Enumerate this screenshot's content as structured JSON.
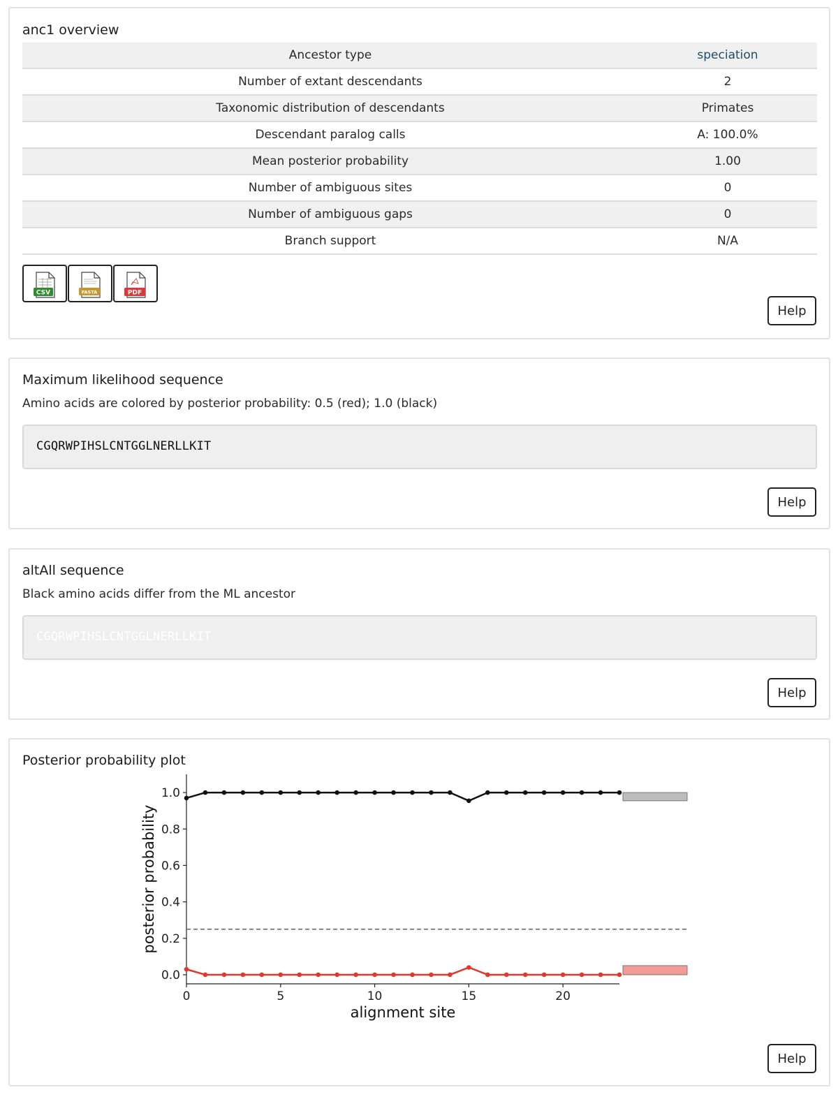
{
  "overview": {
    "title": "anc1 overview",
    "rows": [
      {
        "label": "Ancestor type",
        "value": "speciation"
      },
      {
        "label": "Number of extant descendants",
        "value": "2"
      },
      {
        "label": "Taxonomic distribution of descendants",
        "value": "Primates"
      },
      {
        "label": "Descendant paralog calls",
        "value": "A: 100.0%"
      },
      {
        "label": "Mean posterior probability",
        "value": "1.00"
      },
      {
        "label": "Number of ambiguous sites",
        "value": "0"
      },
      {
        "label": "Number of ambiguous gaps",
        "value": "0"
      },
      {
        "label": "Branch support",
        "value": "N/A"
      }
    ],
    "downloads": [
      {
        "name": "csv-download-button",
        "icon": "csv-file-icon",
        "badge": "CSV",
        "color": "#2e8b2e"
      },
      {
        "name": "fasta-download-button",
        "icon": "fasta-file-icon",
        "badge": "FASTA",
        "color": "#c8962c"
      },
      {
        "name": "pdf-download-button",
        "icon": "pdf-file-icon",
        "badge": "PDF",
        "color": "#d63a3a"
      }
    ],
    "help_label": "Help"
  },
  "ml_sequence": {
    "title": "Maximum likelihood sequence",
    "description": "Amino acids are colored by posterior probability: 0.5 (red); 1.0 (black)",
    "sequence": "CGQRWPIHSLCNTGGLNERLLKIT",
    "help_label": "Help"
  },
  "altall_sequence": {
    "title": "altAll sequence",
    "description": "Black amino acids differ from the ML ancestor",
    "sequence": "CGQRWPIHSLCNTGGLNERLLKIT",
    "help_label": "Help"
  },
  "plot_section": {
    "title": "Posterior probability plot",
    "help_label": "Help"
  },
  "chart_data": {
    "type": "line",
    "xlabel": "alignment site",
    "ylabel": "posterior probability",
    "xlim": [
      0,
      23
    ],
    "ylim": [
      -0.05,
      1.1
    ],
    "xticks": [
      0,
      5,
      10,
      15,
      20
    ],
    "yticks": [
      "0.0",
      "0.2",
      "0.4",
      "0.6",
      "0.8",
      "1.0"
    ],
    "x": [
      0,
      1,
      2,
      3,
      4,
      5,
      6,
      7,
      8,
      9,
      10,
      11,
      12,
      13,
      14,
      15,
      16,
      17,
      18,
      19,
      20,
      21,
      22,
      23
    ],
    "series": [
      {
        "color": "#111111",
        "values": [
          0.97,
          1,
          1,
          1,
          1,
          1,
          1,
          1,
          1,
          1,
          1,
          1,
          1,
          1,
          1,
          0.955,
          1,
          1,
          1,
          1,
          1,
          1,
          1,
          1
        ]
      },
      {
        "color": "#e0382c",
        "values": [
          0.03,
          0,
          0,
          0,
          0,
          0,
          0,
          0,
          0,
          0,
          0,
          0,
          0,
          0,
          0,
          0.04,
          0,
          0,
          0,
          0,
          0,
          0,
          0,
          0
        ]
      }
    ],
    "reference_line": {
      "y": 0.25,
      "style": "dashed",
      "color": "#666666"
    },
    "side_bars": [
      {
        "low": 0.955,
        "high": 1.0,
        "color": "#bdbdbd"
      },
      {
        "low": 0.0,
        "high": 0.05,
        "color": "#f29b94"
      }
    ],
    "grid": false
  }
}
